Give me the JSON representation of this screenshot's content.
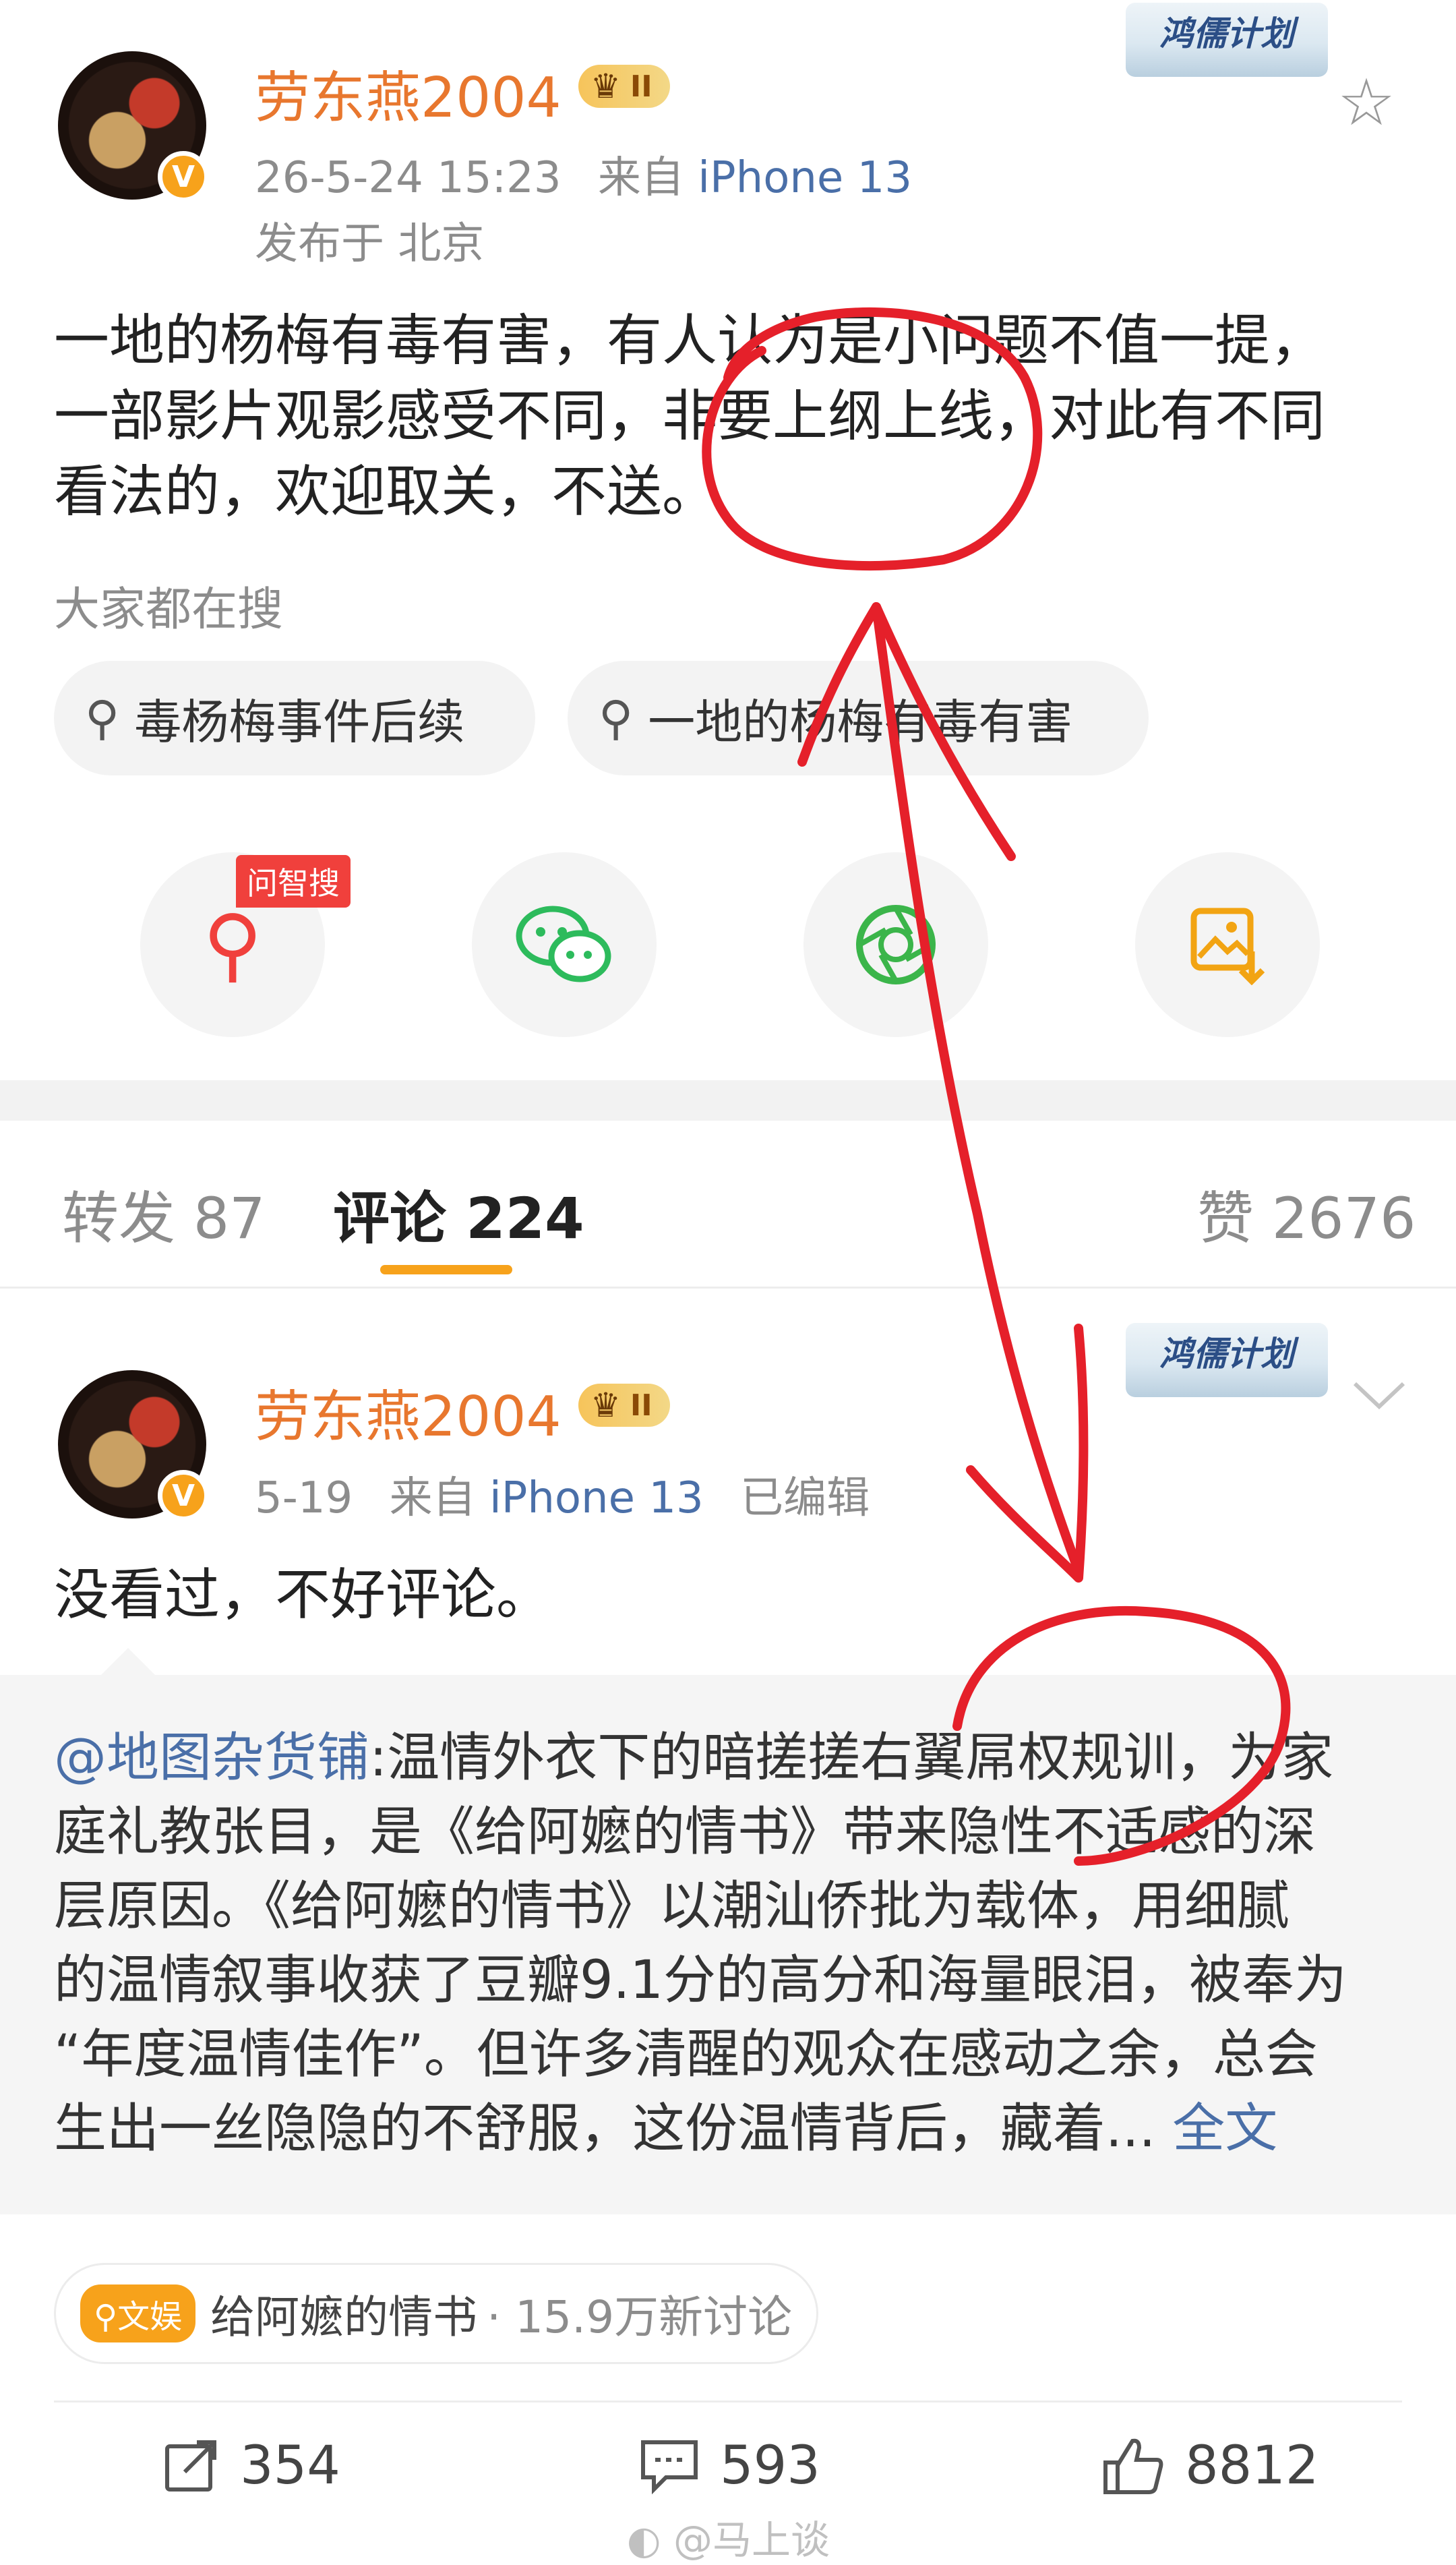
{
  "post": {
    "username": "劳东燕2004",
    "vip_level": "II",
    "promo_badge": "鸿儒计划",
    "timestamp": "26-5-24 15:23",
    "source_prefix": "来自",
    "device": "iPhone 13",
    "location": "发布于 北京",
    "text_lines": [
      "一地的杨梅有毒有害，有人认为是小问题不值一提，",
      "一部影片观影感受不同，非要上纲上线，对此有不同",
      "看法的，欢迎取关，不送。"
    ],
    "search_label": "大家都在搜",
    "search_chips": [
      "毒杨梅事件后续",
      "一地的杨梅有毒有害"
    ],
    "share_badge": "问智搜"
  },
  "tabs": {
    "repost": "转发 87",
    "comments": "评论 224",
    "likes": "赞 2676"
  },
  "comment": {
    "username": "劳东燕2004",
    "vip_level": "II",
    "promo_badge": "鸿儒计划",
    "date": "5-19",
    "source_prefix": "来自",
    "device": "iPhone 13",
    "edited": "已编辑",
    "text": "没看过，不好评论。",
    "quote": {
      "at": "@地图杂货铺",
      "lines": [
        ":温情外衣下的暗搓搓右翼屌权规训，为家",
        "庭礼教张目，是《给阿嬷的情书》带来隐性不适感的深",
        "层原因。《给阿嬷的情书》以潮汕侨批为载体，用细腻",
        "的温情叙事收获了豆瓣9.1分的高分和海量眼泪，被奉为",
        "“年度温情佳作”。但许多清醒的观众在感动之余，总会",
        "生出一丝隐隐的不舒服，这份温情背后，藏着..."
      ],
      "full_text": "全文"
    },
    "topic": {
      "tag": "文娱",
      "name": "给阿嬷的情书",
      "stats": "· 15.9万新讨论"
    },
    "actions": {
      "repost": "354",
      "comment": "593",
      "like": "8812"
    }
  },
  "watermark": "@马上谈",
  "colors": {
    "username": "#e8772e",
    "link": "#4a6fa8",
    "annotation": "#e5202a",
    "tab_underline": "#f7a21b"
  }
}
